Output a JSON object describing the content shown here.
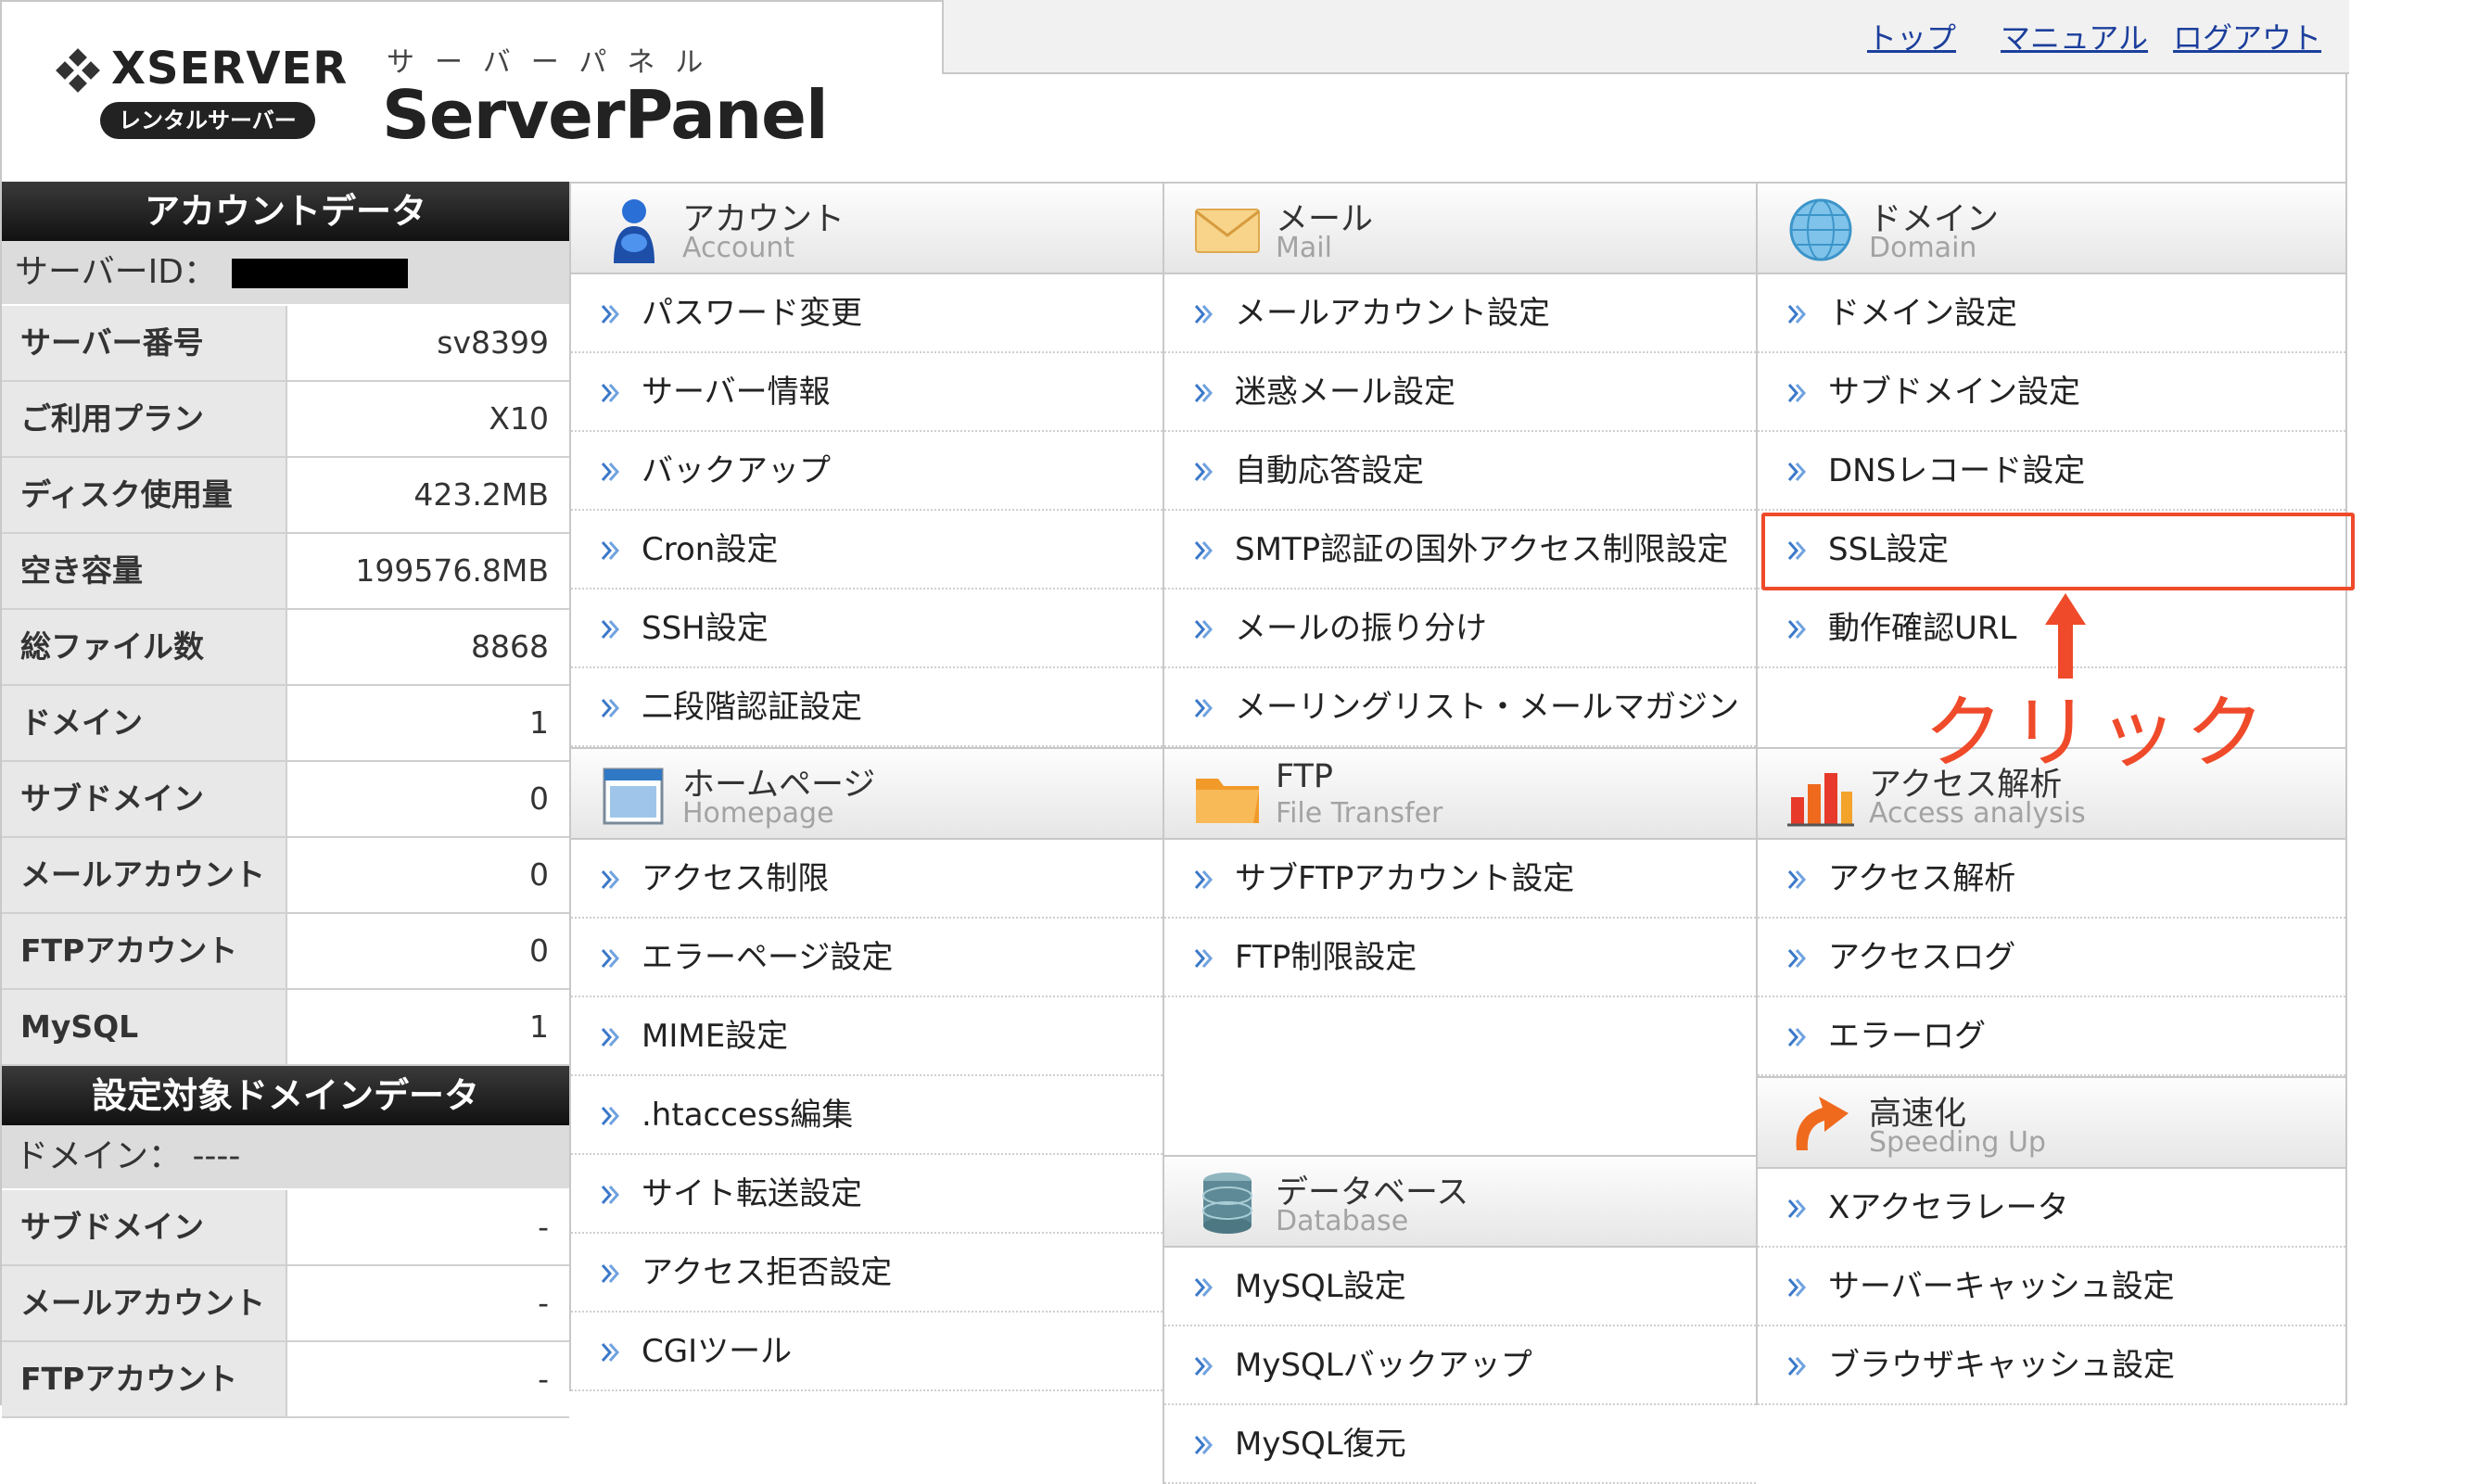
{
  "header": {
    "brand": "XSERVER",
    "brand_sub": "レンタルサーバー",
    "panel_kana": "サーバーパネル",
    "panel_title": "ServerPanel",
    "nav": [
      "トップ",
      "マニュアル",
      "ログアウト"
    ]
  },
  "account": {
    "title": "アカウントデータ",
    "server_id_label": "サーバーID：",
    "rows": [
      {
        "k": "サーバー番号",
        "v": "sv8399"
      },
      {
        "k": "ご利用プラン",
        "v": "X10"
      },
      {
        "k": "ディスク使用量",
        "v": "423.2MB"
      },
      {
        "k": "空き容量",
        "v": "199576.8MB"
      },
      {
        "k": "総ファイル数",
        "v": "8868"
      },
      {
        "k": "ドメイン",
        "v": "1"
      },
      {
        "k": "サブドメイン",
        "v": "0"
      },
      {
        "k": "メールアカウント",
        "v": "0"
      },
      {
        "k": "FTPアカウント",
        "v": "0"
      },
      {
        "k": "MySQL",
        "v": "1"
      }
    ]
  },
  "domain_data": {
    "title": "設定対象ドメインデータ",
    "domain_label": "ドメイン： ----",
    "rows": [
      {
        "k": "サブドメイン",
        "v": "-"
      },
      {
        "k": "メールアカウント",
        "v": "-"
      },
      {
        "k": "FTPアカウント",
        "v": "-"
      }
    ]
  },
  "sections": {
    "account": {
      "jp": "アカウント",
      "en": "Account",
      "icon": "person-icon",
      "items": [
        "パスワード変更",
        "サーバー情報",
        "バックアップ",
        "Cron設定",
        "SSH設定",
        "二段階認証設定"
      ]
    },
    "mail": {
      "jp": "メール",
      "en": "Mail",
      "icon": "envelope-icon",
      "items": [
        "メールアカウント設定",
        "迷惑メール設定",
        "自動応答設定",
        "SMTP認証の国外アクセス制限設定",
        "メールの振り分け",
        "メーリングリスト・メールマガジン"
      ]
    },
    "domain": {
      "jp": "ドメイン",
      "en": "Domain",
      "icon": "globe-icon",
      "items": [
        "ドメイン設定",
        "サブドメイン設定",
        "DNSレコード設定",
        "SSL設定",
        "動作確認URL"
      ]
    },
    "homepage": {
      "jp": "ホームページ",
      "en": "Homepage",
      "icon": "window-icon",
      "items": [
        "アクセス制限",
        "エラーページ設定",
        "MIME設定",
        ".htaccess編集",
        "サイト転送設定",
        "アクセス拒否設定",
        "CGIツール"
      ]
    },
    "ftp": {
      "jp": "FTP",
      "en": "File Transfer",
      "icon": "folder-icon",
      "items": [
        "サブFTPアカウント設定",
        "FTP制限設定"
      ]
    },
    "access": {
      "jp": "アクセス解析",
      "en": "Access analysis",
      "icon": "bar-chart-icon",
      "items": [
        "アクセス解析",
        "アクセスログ",
        "エラーログ"
      ]
    },
    "database": {
      "jp": "データベース",
      "en": "Database",
      "icon": "database-icon",
      "items": [
        "MySQL設定",
        "MySQLバックアップ",
        "MySQL復元"
      ]
    },
    "speed": {
      "jp": "高速化",
      "en": "Speeding Up",
      "icon": "speed-arrow-icon",
      "items": [
        "Xアクセラレータ",
        "サーバーキャッシュ設定",
        "ブラウザキャッシュ設定"
      ]
    }
  },
  "annotation": {
    "label": "クリック",
    "color": "#ef4a2a"
  },
  "colors": {
    "link": "#1c3f9c",
    "sidebar_title_bg": "#111111",
    "highlight": "#ef4a2a"
  }
}
